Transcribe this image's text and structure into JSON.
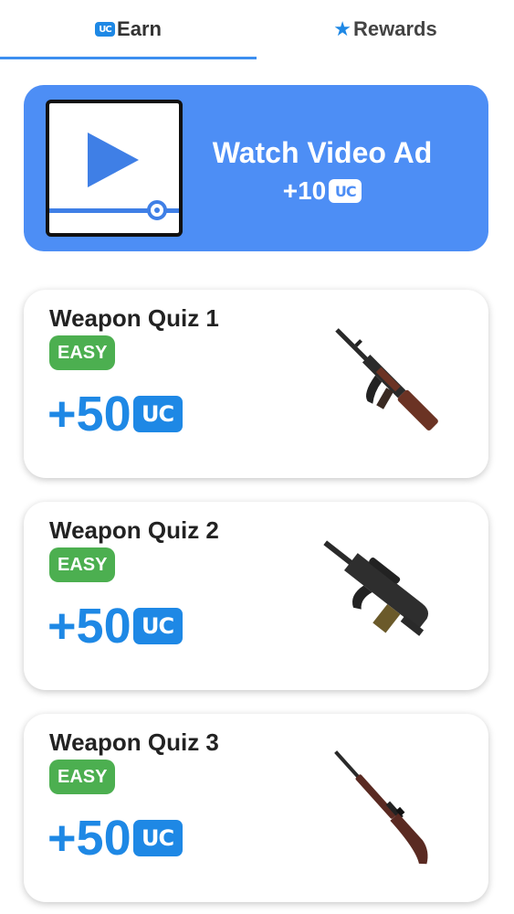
{
  "tabs": {
    "earn": {
      "badge": "UC",
      "label": "Earn",
      "active": true
    },
    "rewards": {
      "icon": "star-icon",
      "label": "Rewards",
      "active": false
    }
  },
  "ad": {
    "title": "Watch Video Ad",
    "reward": "+10",
    "currency": "UC",
    "icon": "play-video-icon"
  },
  "quizzes": [
    {
      "title": "Weapon Quiz 1",
      "difficulty": "EASY",
      "reward": "+50",
      "currency": "UC",
      "weapon_icon": "assault-rifle-icon"
    },
    {
      "title": "Weapon Quiz 2",
      "difficulty": "EASY",
      "reward": "+50",
      "currency": "UC",
      "weapon_icon": "bullpup-rifle-icon"
    },
    {
      "title": "Weapon Quiz 3",
      "difficulty": "EASY",
      "reward": "+50",
      "currency": "UC",
      "weapon_icon": "bolt-action-rifle-icon"
    }
  ],
  "colors": {
    "accent": "#1e88e5",
    "banner": "#4d8ef5",
    "easy": "#4caf50"
  }
}
